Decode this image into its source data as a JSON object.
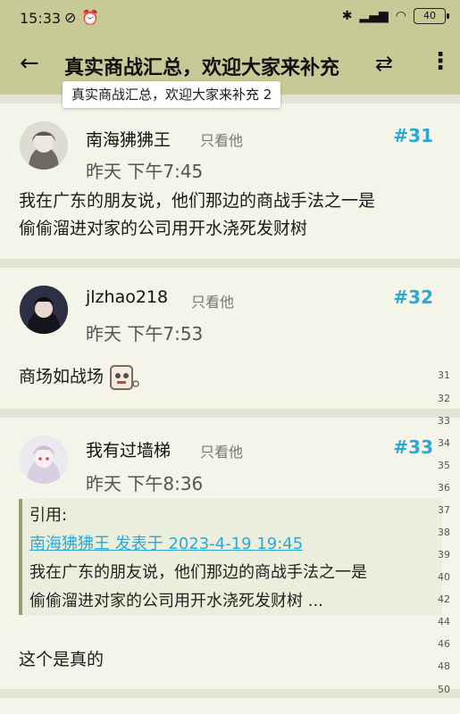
{
  "status_bar": {
    "time": "15:33",
    "battery": "40"
  },
  "app_bar": {
    "title": "真实商战汇总，欢迎大家来补充",
    "tooltip": "真实商战汇总，欢迎大家来补充 2"
  },
  "posts": [
    {
      "author": "南海狒狒王",
      "only_him": "只看他",
      "floor": "#31",
      "time": "昨天 下午7:45",
      "lines": [
        "我在广东的朋友说，他们那边的商战手法之一是",
        "偷偷溜进对家的公司用开水浇死发财树"
      ]
    },
    {
      "author": "jlzhao218",
      "only_him": "只看他",
      "floor": "#32",
      "time": "昨天 下午7:53",
      "lines": [
        "商场如战场"
      ]
    },
    {
      "author": "我有过墙梯",
      "only_him": "只看他",
      "floor": "#33",
      "time": "昨天 下午8:36",
      "quote": {
        "label": "引用:",
        "source": "南海狒狒王 发表于 2023-4-19 19:45",
        "lines": [
          "我在广东的朋友说，他们那边的商战手法之一是",
          "偷偷溜进对家的公司用开水浇死发财树 ..."
        ]
      },
      "lines": [
        "这个是真的"
      ]
    }
  ],
  "gutter_numbers": [
    "31",
    "32",
    "33",
    "34",
    "35",
    "36",
    "37",
    "38",
    "39",
    "40",
    "42",
    "44",
    "46",
    "48",
    "50"
  ],
  "colors": {
    "bar": "#c7c996",
    "floor": "#2aa8d8",
    "background": "#eef0e0"
  },
  "icons": [
    "back-arrow-icon",
    "swap-icon",
    "more-vert-icon",
    "emoji-icon"
  ]
}
